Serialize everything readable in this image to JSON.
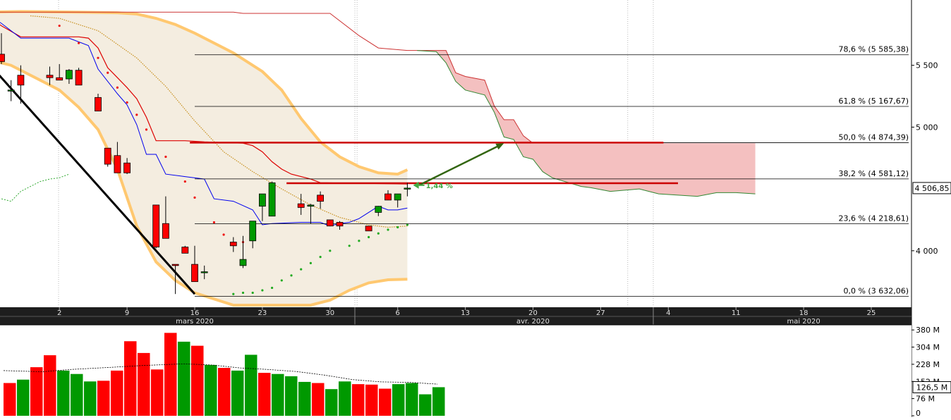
{
  "chart_data": [
    {
      "type": "candlestick",
      "y_axis_ticks": [
        {
          "value": 5500,
          "label": "5 500"
        },
        {
          "value": 5000,
          "label": "5 000"
        },
        {
          "value": 4000,
          "label": "4 000"
        }
      ],
      "ylim": [
        3560,
        5960
      ],
      "last_price": {
        "value": 4506.85,
        "label": "4 506,85"
      },
      "change_annotation": {
        "value": 4530,
        "label": "1,44 %"
      },
      "x_axis_ticks": [
        {
          "day": 2,
          "label": "2"
        },
        {
          "day": 9,
          "label": "9"
        },
        {
          "day": 16,
          "label": "16"
        },
        {
          "day": 23,
          "label": "23"
        },
        {
          "day": 30,
          "label": "30"
        },
        {
          "day": 37,
          "label": "6"
        },
        {
          "day": 44,
          "label": "13"
        },
        {
          "day": 51,
          "label": "20"
        },
        {
          "day": 58,
          "label": "27"
        },
        {
          "day": 65,
          "label": "4"
        },
        {
          "day": 72,
          "label": "11"
        },
        {
          "day": 79,
          "label": "18"
        },
        {
          "day": 86,
          "label": "25"
        }
      ],
      "month_labels": [
        {
          "day": 16,
          "label": "mars 2020"
        },
        {
          "day": 51,
          "label": "avr. 2020"
        },
        {
          "day": 79,
          "label": "mai 2020"
        }
      ],
      "fibonacci_levels": [
        {
          "value": 5585.38,
          "label": "78,6 % (5 585,38)"
        },
        {
          "value": 5167.67,
          "label": "61,8 % (5 167,67)"
        },
        {
          "value": 4874.39,
          "label": "50,0 % (4 874,39)"
        },
        {
          "value": 4581.12,
          "label": "38,2 % (4 581,12)"
        },
        {
          "value": 4218.61,
          "label": "23,6 % (4 218,61)"
        },
        {
          "value": 3632.06,
          "label": "0,0 % (3 632,06)"
        }
      ],
      "horizontal_resistances": [
        {
          "value": 4874.39,
          "x_start": 15.5,
          "x_end": 64.5
        },
        {
          "value": 4546,
          "x_start": 25.5,
          "x_end": 66
        }
      ],
      "trendline": {
        "x": [
          -6,
          16
        ],
        "y": [
          5575,
          3650
        ]
      },
      "candles": [
        {
          "day": -6,
          "open": 5760,
          "high": 5860,
          "low": 5700,
          "close": 5860
        },
        {
          "day": -5,
          "open": 5790,
          "high": 5830,
          "low": 5640,
          "close": 5760
        },
        {
          "day": -4,
          "open": 5590,
          "high": 5760,
          "low": 5510,
          "close": 5530
        },
        {
          "day": -3,
          "open": 5300,
          "high": 5380,
          "low": 5210,
          "close": 5300
        },
        {
          "day": -2,
          "open": 5420,
          "high": 5500,
          "low": 5190,
          "close": 5340
        },
        {
          "day": 1,
          "open": 5420,
          "high": 5490,
          "low": 5340,
          "close": 5400
        },
        {
          "day": 2,
          "open": 5400,
          "high": 5510,
          "low": 5380,
          "close": 5380
        },
        {
          "day": 3,
          "open": 5390,
          "high": 5470,
          "low": 5350,
          "close": 5460
        },
        {
          "day": 4,
          "open": 5460,
          "high": 5480,
          "low": 5340,
          "close": 5340
        },
        {
          "day": 6,
          "open": 5240,
          "high": 5270,
          "low": 5130,
          "close": 5130
        },
        {
          "day": 7,
          "open": 4830,
          "high": 4830,
          "low": 4680,
          "close": 4700
        },
        {
          "day": 8,
          "open": 4770,
          "high": 4880,
          "low": 4630,
          "close": 4630
        },
        {
          "day": 9,
          "open": 4710,
          "high": 4750,
          "low": 4620,
          "close": 4630
        },
        {
          "day": 12,
          "open": 4370,
          "high": 4370,
          "low": 4020,
          "close": 4030
        },
        {
          "day": 13,
          "open": 4220,
          "high": 4440,
          "low": 4140,
          "close": 4100
        },
        {
          "day": 14,
          "open": 3890,
          "high": 3880,
          "low": 3650,
          "close": 3880
        },
        {
          "day": 15,
          "open": 4030,
          "high": 4040,
          "low": 3990,
          "close": 3980
        },
        {
          "day": 16,
          "open": 3890,
          "high": 4040,
          "low": 3780,
          "close": 3750
        },
        {
          "day": 17,
          "open": 3830,
          "high": 3880,
          "low": 3770,
          "close": 3830
        },
        {
          "day": 20,
          "open": 4070,
          "high": 4110,
          "low": 3990,
          "close": 4040
        },
        {
          "day": 21,
          "open": 3880,
          "high": 4120,
          "low": 3860,
          "close": 3930
        },
        {
          "day": 22,
          "open": 4080,
          "high": 4240,
          "low": 4020,
          "close": 4240
        },
        {
          "day": 23,
          "open": 4360,
          "high": 4440,
          "low": 4240,
          "close": 4460
        },
        {
          "day": 24,
          "open": 4280,
          "high": 4560,
          "low": 4290,
          "close": 4550
        },
        {
          "day": 27,
          "open": 4380,
          "high": 4460,
          "low": 4290,
          "close": 4350
        },
        {
          "day": 28,
          "open": 4360,
          "high": 4380,
          "low": 4220,
          "close": 4370
        },
        {
          "day": 29,
          "open": 4450,
          "high": 4480,
          "low": 4340,
          "close": 4400
        },
        {
          "day": 30,
          "open": 4250,
          "high": 4250,
          "low": 4200,
          "close": 4200
        },
        {
          "day": 31,
          "open": 4230,
          "high": 4240,
          "low": 4170,
          "close": 4200
        },
        {
          "day": 34,
          "open": 4200,
          "high": 4200,
          "low": 4160,
          "close": 4160
        },
        {
          "day": 35,
          "open": 4310,
          "high": 4330,
          "low": 4280,
          "close": 4360
        },
        {
          "day": 36,
          "open": 4460,
          "high": 4490,
          "low": 4410,
          "close": 4410
        },
        {
          "day": 37,
          "open": 4410,
          "high": 4460,
          "low": 4350,
          "close": 4460
        },
        {
          "day": 38,
          "open": 4500,
          "high": 4550,
          "low": 4440,
          "close": 4507
        }
      ],
      "volume_panel": {
        "y_axis_ticks": [
          {
            "value": 380,
            "label": "380 M"
          },
          {
            "value": 304,
            "label": "304 M"
          },
          {
            "value": 228,
            "label": "228 M"
          },
          {
            "value": 152,
            "label": "152 M"
          },
          {
            "value": 76,
            "label": "76 M"
          },
          {
            "value": 0,
            "label": "0"
          }
        ],
        "ylim": [
          0,
          390
        ],
        "last_value": {
          "value": 126.5,
          "label": "126,5 M"
        },
        "bars": [
          {
            "value": 145,
            "color": "#ff0000"
          },
          {
            "value": 160,
            "color": "#009900"
          },
          {
            "value": 215,
            "color": "#ff0000"
          },
          {
            "value": 268,
            "color": "#ff0000"
          },
          {
            "value": 200,
            "color": "#009900"
          },
          {
            "value": 185,
            "color": "#009900"
          },
          {
            "value": 152,
            "color": "#009900"
          },
          {
            "value": 155,
            "color": "#ff0000"
          },
          {
            "value": 200,
            "color": "#ff0000"
          },
          {
            "value": 330,
            "color": "#ff0000"
          },
          {
            "value": 278,
            "color": "#ff0000"
          },
          {
            "value": 205,
            "color": "#ff0000"
          },
          {
            "value": 367,
            "color": "#ff0000"
          },
          {
            "value": 328,
            "color": "#009900"
          },
          {
            "value": 310,
            "color": "#ff0000"
          },
          {
            "value": 225,
            "color": "#009900"
          },
          {
            "value": 212,
            "color": "#ff0000"
          },
          {
            "value": 200,
            "color": "#009900"
          },
          {
            "value": 270,
            "color": "#009900"
          },
          {
            "value": 190,
            "color": "#ff0000"
          },
          {
            "value": 185,
            "color": "#009900"
          },
          {
            "value": 175,
            "color": "#009900"
          },
          {
            "value": 150,
            "color": "#009900"
          },
          {
            "value": 145,
            "color": "#ff0000"
          },
          {
            "value": 118,
            "color": "#009900"
          },
          {
            "value": 152,
            "color": "#009900"
          },
          {
            "value": 140,
            "color": "#ff0000"
          },
          {
            "value": 138,
            "color": "#ff0000"
          },
          {
            "value": 120,
            "color": "#ff0000"
          },
          {
            "value": 140,
            "color": "#009900"
          },
          {
            "value": 145,
            "color": "#009900"
          },
          {
            "value": 95,
            "color": "#009900"
          },
          {
            "value": 126.5,
            "color": "#009900"
          }
        ]
      }
    }
  ],
  "colors": {
    "bull": "#009900",
    "bear": "#ff0000",
    "cloud_bear": "#f4c0c0",
    "bollinger": "#ffc870",
    "bollinger_fill": "#f4ede0",
    "kijun": "#dd0000",
    "tenkan": "#0000ee",
    "psar_bear": "#ee1111",
    "psar_bull": "#22aa22",
    "mma": "#c8901e",
    "fib_line": "#000000",
    "resistance": "#cc0000",
    "arrow": "#336611",
    "axis_panel": "#1e1e1e",
    "ruler": "#2a2a2a"
  }
}
